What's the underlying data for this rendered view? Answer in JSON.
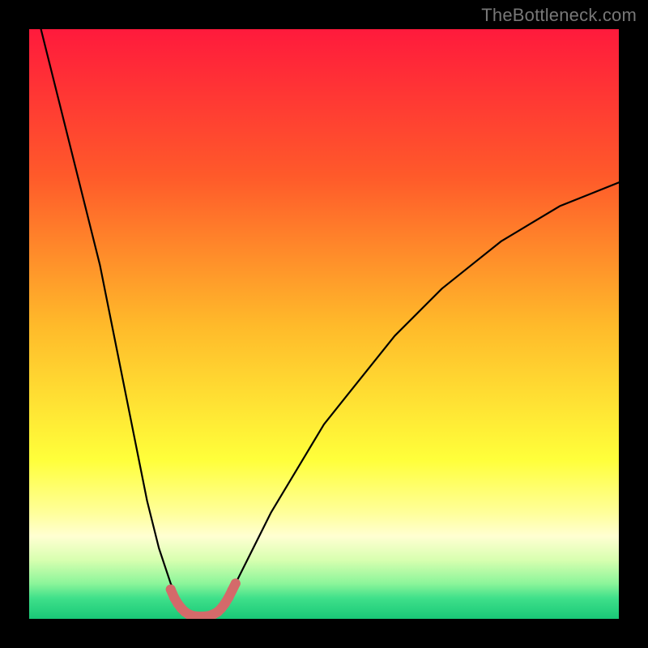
{
  "watermark": "TheBottleneck.com",
  "chart_data": {
    "type": "line",
    "title": "",
    "xlabel": "",
    "ylabel": "",
    "xlim": [
      0,
      100
    ],
    "ylim": [
      0,
      100
    ],
    "grid": false,
    "legend": false,
    "background_gradient": {
      "stops": [
        {
          "offset": 0.0,
          "color": "#ff1a3c"
        },
        {
          "offset": 0.25,
          "color": "#ff5a2a"
        },
        {
          "offset": 0.5,
          "color": "#ffb92a"
        },
        {
          "offset": 0.73,
          "color": "#ffff3a"
        },
        {
          "offset": 0.82,
          "color": "#ffff9a"
        },
        {
          "offset": 0.86,
          "color": "#ffffd2"
        },
        {
          "offset": 0.9,
          "color": "#d8ffb0"
        },
        {
          "offset": 0.94,
          "color": "#8cf59a"
        },
        {
          "offset": 0.965,
          "color": "#3fe08a"
        },
        {
          "offset": 1.0,
          "color": "#19c877"
        }
      ]
    },
    "series": [
      {
        "name": "left-curve",
        "stroke": "#000000",
        "stroke_width": 2.2,
        "x": [
          2,
          3,
          4,
          5,
          6,
          7,
          8,
          9,
          10,
          11,
          12,
          13,
          14,
          15,
          16,
          17,
          18,
          19,
          20,
          21,
          22,
          23,
          24,
          25,
          26
        ],
        "y": [
          100,
          96,
          92,
          88,
          84,
          80,
          76,
          72,
          68,
          64,
          60,
          55,
          50,
          45,
          40,
          35,
          30,
          25,
          20,
          16,
          12,
          9,
          6,
          4,
          2
        ]
      },
      {
        "name": "right-curve",
        "stroke": "#000000",
        "stroke_width": 2.2,
        "x": [
          33,
          34,
          35,
          37,
          39,
          41,
          44,
          47,
          50,
          54,
          58,
          62,
          66,
          70,
          75,
          80,
          85,
          90,
          95,
          100
        ],
        "y": [
          2,
          4,
          6,
          10,
          14,
          18,
          23,
          28,
          33,
          38,
          43,
          48,
          52,
          56,
          60,
          64,
          67,
          70,
          72,
          74
        ]
      },
      {
        "name": "bottom-highlight",
        "stroke": "#d46a6a",
        "stroke_width": 12,
        "linecap": "round",
        "x": [
          24.0,
          24.6,
          25.2,
          25.8,
          26.4,
          27.0,
          27.8,
          28.7,
          29.6,
          30.5,
          31.3,
          32.0,
          32.6,
          33.2,
          33.8,
          34.4,
          35.0
        ],
        "y": [
          5.0,
          3.6,
          2.6,
          1.8,
          1.2,
          0.8,
          0.5,
          0.4,
          0.4,
          0.5,
          0.8,
          1.2,
          1.8,
          2.6,
          3.6,
          4.8,
          6.0
        ]
      }
    ]
  }
}
